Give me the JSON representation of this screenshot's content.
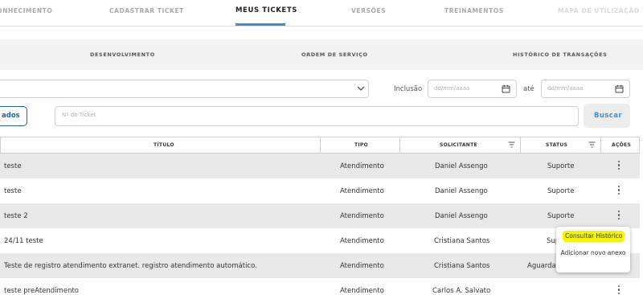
{
  "top_tabs": [
    {
      "label": "CONHECIMENTO"
    },
    {
      "label": "CADASTRAR TICKET"
    },
    {
      "label": "MEUS TICKETS"
    },
    {
      "label": "VERSÕES"
    },
    {
      "label": "TREINAMENTOS"
    },
    {
      "label": "MAPA DE UTILIZAÇÃO"
    }
  ],
  "sub_tabs": [
    {
      "label": "DESENVOLVIMENTO"
    },
    {
      "label": "ORDEM DE SERVIÇO"
    },
    {
      "label": "HISTÓRICO DE TRANSAÇÕES"
    }
  ],
  "filters": {
    "inclusao_label": "Inclusão",
    "ate_label": "até",
    "date_from_placeholder": "dd/mm/aaaa",
    "date_to_placeholder": "dd/mm/aaaa",
    "left_button_label": "ados",
    "ticket_placeholder": "Nº do Ticket",
    "search_button_label": "Buscar"
  },
  "table": {
    "headers": [
      "TÍTULO",
      "TIPO",
      "SOLICITANTE",
      "STATUS",
      "AÇÕES"
    ],
    "rows": [
      {
        "titulo": "teste",
        "tipo": "Atendimento",
        "solicitante": "Daniel Assengo",
        "status": "Suporte"
      },
      {
        "titulo": "teste",
        "tipo": "Atendimento",
        "solicitante": "Daniel Assengo",
        "status": "Suporte"
      },
      {
        "titulo": "teste 2",
        "tipo": "Atendimento",
        "solicitante": "Daniel Assengo",
        "status": "Suporte"
      },
      {
        "titulo": "24/11 teste",
        "tipo": "Atendimento",
        "solicitante": "Cristiana Santos",
        "status": "Sup"
      },
      {
        "titulo": "Teste de registro atendimento extranet.  registro atendimento automático.",
        "tipo": "Atendimento",
        "solicitante": "Cristiana Santos",
        "status": "Aguardar"
      },
      {
        "titulo": "teste preAtendimento",
        "tipo": "Atendimento",
        "solicitante": "Carlos A. Salvato",
        "status": ""
      }
    ]
  },
  "actions_menu": {
    "option1": "Consultar Histórico",
    "option2": "Adicionar novo anexo"
  },
  "colors": {
    "accent": "#3d8fd6",
    "primary_button_border": "#1f5fa8",
    "highlight": "#f5f500"
  }
}
